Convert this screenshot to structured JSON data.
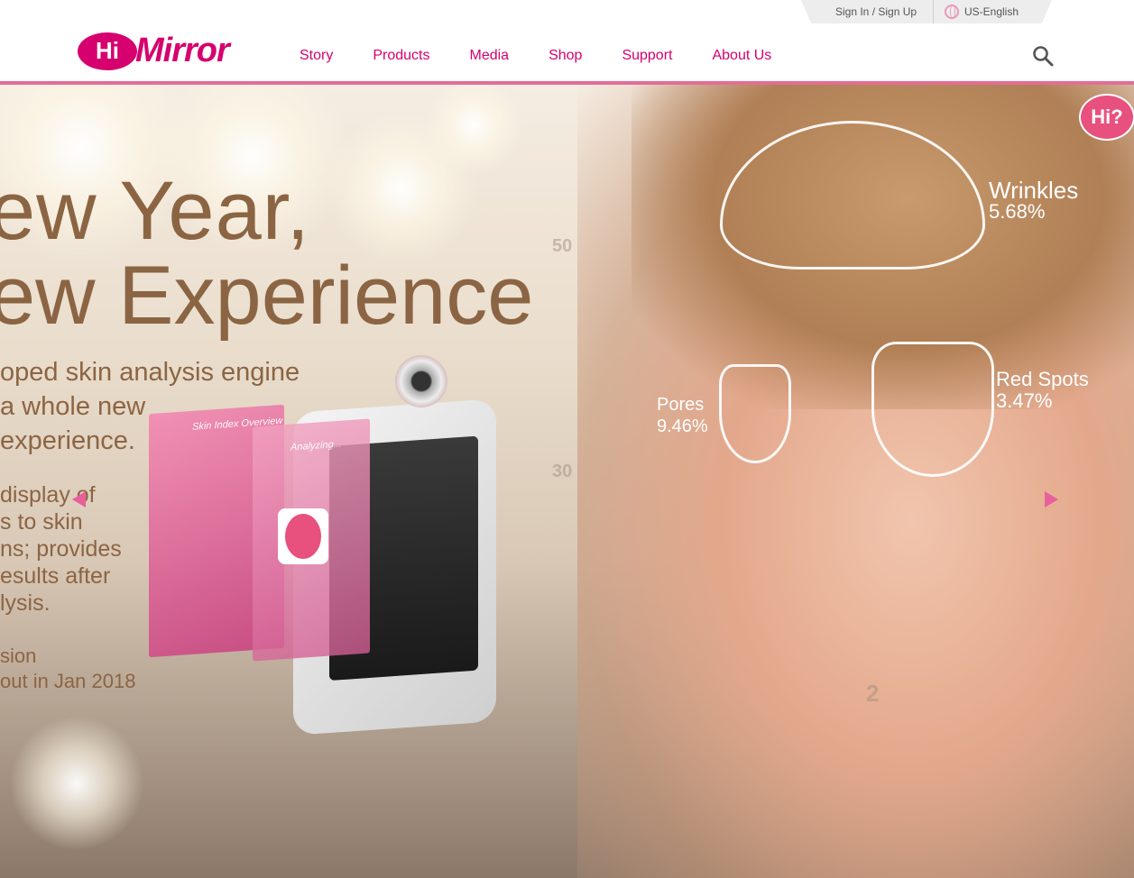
{
  "utility": {
    "signin": "Sign In / Sign Up",
    "language": "US-English"
  },
  "header": {
    "logo_hi": "Hi",
    "logo_text": "Mirror",
    "nav": [
      "Story",
      "Products",
      "Media",
      "Shop",
      "Support",
      "About Us"
    ]
  },
  "hero": {
    "title_line1": "ew Year,",
    "title_line2": "ew Experience",
    "subtitle": [
      "oped skin analysis engine",
      "a whole new",
      "experience."
    ],
    "description": [
      "display of",
      "s to skin",
      "ns; provides",
      "esults after",
      "lysis."
    ],
    "version": [
      "sion",
      "out in Jan 2018"
    ],
    "device": {
      "card1_title": "Skin Index Overview",
      "card2_title": "Analyzing..."
    },
    "labels": {
      "wrinkles_name": "Wrinkles",
      "wrinkles_value": "5.68%",
      "pores_name": "Pores",
      "pores_value": "9.46%",
      "redspots_name": "Red Spots",
      "redspots_value": "3.47%"
    },
    "bg_chart_ticks": [
      "50",
      "30",
      "2"
    ],
    "chat_bubble": "Hi?"
  },
  "colors": {
    "brand": "#d6006e",
    "accent_line": "#e46d97",
    "text_brown": "#8b6543"
  },
  "icons": [
    "globe-icon",
    "search-icon",
    "chevron-left-icon",
    "chevron-right-icon"
  ]
}
